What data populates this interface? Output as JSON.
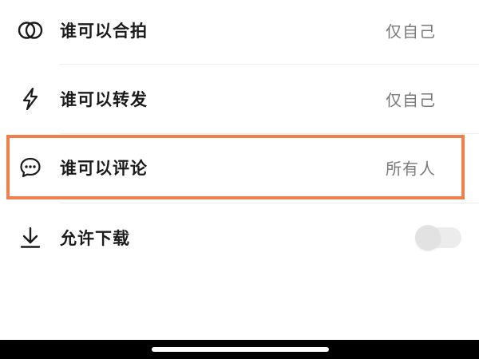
{
  "settings": {
    "items": [
      {
        "label": "谁可以合拍",
        "value": "仅自己",
        "icon": "duet-icon"
      },
      {
        "label": "谁可以转发",
        "value": "仅自己",
        "icon": "lightning-icon"
      },
      {
        "label": "谁可以评论",
        "value": "所有人",
        "icon": "comment-icon"
      },
      {
        "label": "允许下载",
        "toggle_on": false,
        "icon": "download-icon"
      }
    ]
  },
  "colors": {
    "highlight_border": "#f07f4e",
    "label_text": "#1b1b1b",
    "value_text": "#7a7a7a"
  }
}
